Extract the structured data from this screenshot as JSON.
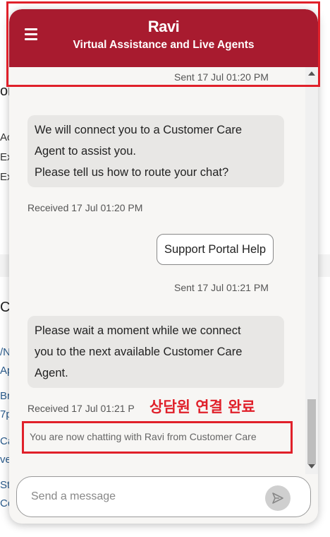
{
  "header": {
    "title": "Ravi",
    "subtitle": "Virtual Assistance and Live Agents"
  },
  "background_fragments": [
    "or",
    "Ac",
    "Ex",
    "Ex",
    "Cr",
    "/N",
    "Ap",
    "Bre",
    "7p",
    "Ca",
    "ve",
    "Sta",
    "Co"
  ],
  "messages": [
    {
      "direction": "sent",
      "timestamp": "Sent  17 Jul 01:20 PM"
    },
    {
      "direction": "received",
      "lines": [
        "We will connect you to a Customer Care",
        "Agent to assist you.",
        "Please tell us how to route your chat?"
      ],
      "timestamp": "Received  17 Jul 01:20 PM"
    },
    {
      "direction": "sent",
      "text": "Support Portal Help",
      "timestamp": "Sent  17 Jul 01:21 PM"
    },
    {
      "direction": "received",
      "lines": [
        "Please wait a moment while we connect",
        "you to the next available Customer Care",
        "Agent."
      ],
      "timestamp": "Received  17 Jul 01:21 P"
    }
  ],
  "system_message": "You are now chatting with Ravi from Customer Care",
  "annotation": "상담원 연결 완료",
  "composer": {
    "placeholder": "Send a message"
  },
  "icons": {
    "menu": "hamburger-menu-icon",
    "send": "send-arrow-icon"
  },
  "colors": {
    "header_bg": "#a81b2f",
    "annotation_red": "#e0202a"
  }
}
